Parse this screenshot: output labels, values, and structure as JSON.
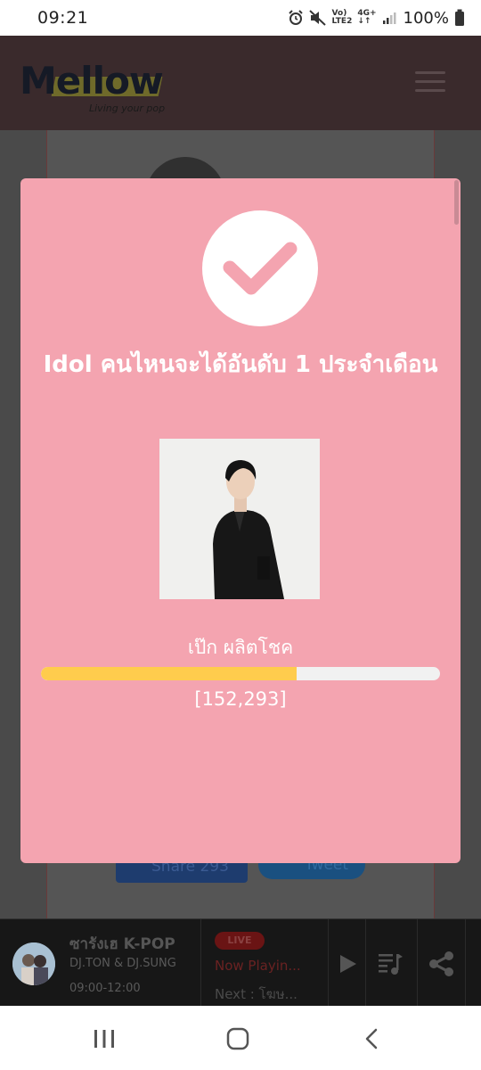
{
  "status_bar": {
    "time": "09:21",
    "network_label_top": "Vo)",
    "network_label_bottom": "LTE2",
    "network_type": "4G+",
    "battery": "100%",
    "icons": [
      "alarm-icon",
      "mute-icon",
      "signal-icon",
      "battery-icon"
    ]
  },
  "site_header": {
    "logo": "Mellow",
    "tagline": "Living your pop",
    "menu_icon": "hamburger-icon"
  },
  "background": {
    "share_facebook": "Share 293",
    "share_twitter": "Tweet"
  },
  "modal": {
    "icon": "checkmark-icon",
    "title": "Idol คนไหนจะได้อันดับ 1 ประจำเดือน",
    "idol_name": "เป๊ก ผลิตโชค",
    "vote_count": "[152,293]",
    "progress_fraction": 0.64,
    "colors": {
      "background": "#f4a4b0",
      "progress": "#ffcc4d",
      "check": "#f4a4b0"
    }
  },
  "player": {
    "show_title": "ซารังเฮ K-POP",
    "djs": "DJ.TON & DJ.SUNG",
    "time": "09:00-12:00",
    "live_label": "LIVE",
    "now_playing": "Now Playin...",
    "next": "Next : โฆษ...",
    "buttons": [
      "play-icon",
      "playlist-icon",
      "share-icon"
    ]
  },
  "nav_bar": {
    "buttons": [
      "recent-apps-icon",
      "home-icon",
      "back-icon"
    ]
  }
}
